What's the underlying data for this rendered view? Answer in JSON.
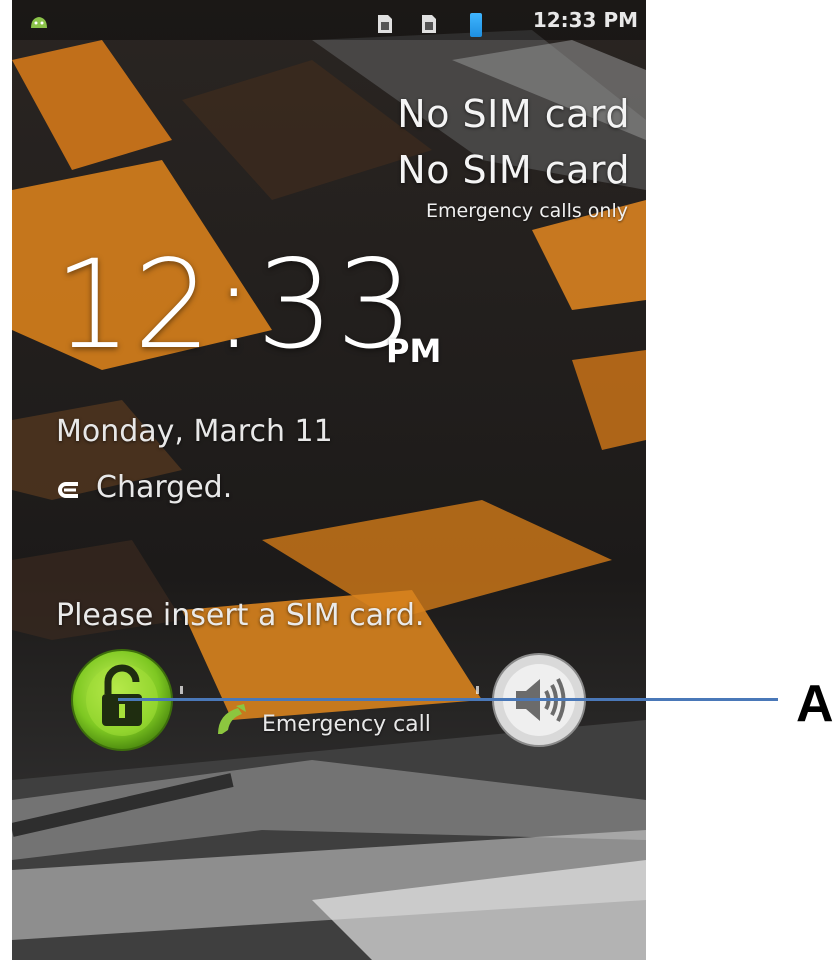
{
  "status_bar": {
    "time": "12:33 PM",
    "icons": [
      "android-notification-icon",
      "no-sim-icon",
      "no-sim-icon",
      "battery-icon"
    ]
  },
  "carrier": {
    "line1": "No SIM card",
    "line2": "No SIM card",
    "emergency_only": "Emergency calls only"
  },
  "clock": {
    "time": "12:33",
    "ampm": "PM"
  },
  "date": "Monday, March 11",
  "charging": {
    "icon": "charging-icon",
    "text": "Charged."
  },
  "sim_message": "Please insert a SIM card.",
  "controls": {
    "unlock_icon": "unlock-icon",
    "sound_icon": "sound-icon",
    "emergency_call_label": "Emergency call"
  },
  "annotation": {
    "label": "A",
    "line_color": "#4a78b8"
  },
  "colors": {
    "unlock_green": "#7ec822",
    "orange_stripe": "#e08a1e"
  }
}
